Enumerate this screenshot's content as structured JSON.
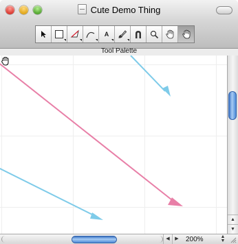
{
  "window": {
    "title": "Cute Demo Thing",
    "close_glyph": "",
    "toolbar_label": "Tool Palette"
  },
  "toolbar": {
    "tools": [
      {
        "name": "arrow-select-tool",
        "icon": "arrow-pointer-icon",
        "text": "",
        "has_menu": false,
        "selected": false
      },
      {
        "name": "rectangle-tool",
        "icon": "rectangle-icon",
        "text": "",
        "has_menu": true,
        "selected": false
      },
      {
        "name": "polygon-tool",
        "icon": "triangle-icon",
        "text": "",
        "has_menu": true,
        "selected": false
      },
      {
        "name": "curve-tool",
        "icon": "curve-icon",
        "text": "",
        "has_menu": true,
        "selected": false
      },
      {
        "name": "text-tool",
        "icon": "text-a-icon",
        "text": "A",
        "has_menu": true,
        "selected": false
      },
      {
        "name": "brush-tool",
        "icon": "brush-icon",
        "text": "",
        "has_menu": true,
        "selected": false
      },
      {
        "name": "magnet-tool",
        "icon": "magnet-icon",
        "text": "",
        "has_menu": false,
        "selected": false
      },
      {
        "name": "zoom-tool",
        "icon": "magnifier-icon",
        "text": "",
        "has_menu": false,
        "selected": false
      },
      {
        "name": "hand-tool",
        "icon": "hand-icon",
        "text": "",
        "has_menu": false,
        "selected": false
      },
      {
        "name": "grab-hand-tool",
        "icon": "grab-hand-icon",
        "text": "",
        "has_menu": false,
        "selected": true
      }
    ]
  },
  "canvas": {
    "grid_color": "#eeeeee",
    "arrows": [
      {
        "name": "pink-arrow",
        "color": "#e87fa7"
      },
      {
        "name": "blue-arrow-top",
        "color": "#7ecbe9"
      },
      {
        "name": "blue-arrow-bottom",
        "color": "#7ecbe9"
      }
    ],
    "cursor_icon": "grab-hand-cursor-icon"
  },
  "status": {
    "zoom_level": "200%"
  },
  "colors": {
    "scroll_thumb": "#4c8ad8",
    "selected_tool": "#b0b0b0"
  }
}
